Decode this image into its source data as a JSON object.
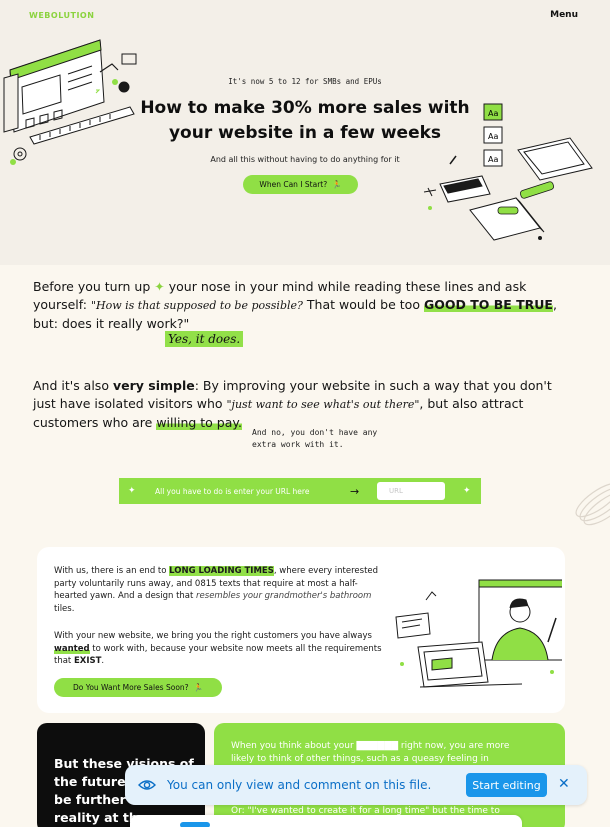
{
  "header": {
    "logo": "WEBOLUTION",
    "menu_label": "Menu"
  },
  "hero": {
    "kicker": "It's now 5 to 12 for SMBs and EPUs",
    "title_line1": "How to make 30% more sales with",
    "title_line2": "your website in a few weeks",
    "subtitle": "And all this without having to do anything for it",
    "cta_label": "When Can I Start?",
    "cta_icon": "running-person-icon",
    "art_labels": [
      "Aa",
      "Aa",
      "Aa"
    ]
  },
  "intro": {
    "p1_a": "Before you turn up",
    "p1_b": "your nose in your mind while reading these lines and ask yourself:",
    "p1_quote": "\"How is that supposed to be possible?",
    "p1_c": "That would be too",
    "p1_bold": "GOOD TO BE TRUE",
    "p1_d": ", but: does it really work?\"",
    "yes": "Yes, it does.",
    "p2_a": "And it's also",
    "p2_bold": "very simple",
    "p2_b": ": By improving your website in such a way that you don't just have isolated visitors who",
    "p2_quote": "\"just want to see what's out there\"",
    "p2_c": ", but also attract customers who are",
    "p2_hl": "willing to pay.",
    "note": "And no, you don't have any\nextra work with it."
  },
  "url_bar": {
    "text": "All you have to do is enter your URL here",
    "placeholder": "URL",
    "arrow_icon": "arrow-right-icon"
  },
  "benefits_card": {
    "t1_a": "With us, there is an end to",
    "t1_hl": "LONG LOADING TIMES",
    "t1_b": ", where every interested party voluntarily runs away, and 0815 texts that require at most a half-hearted yawn. And a design that",
    "t1_it": "resembles your grandmother's bathroom",
    "t1_c": "tiles.",
    "t2_a": "With your new website, we bring you the right customers you have always",
    "t2_hl": "wanted",
    "t2_b": "to work with, because your website now meets all the requirements that",
    "t2_bold": "EXIST",
    "t2_c": ".",
    "cta_label": "Do You Want More Sales Soon?"
  },
  "bottom": {
    "black_text": "But these visions of\nthe future c\nbe further fr\nreality at the",
    "green_text": "When you think about your ▇▇▇▇▇▇ right now, you are more likely to think of other things, such as a queasy feeling in",
    "green_text2": "Or: \"I've wanted to create it for a long time\" but the time to"
  },
  "banner": {
    "message": "You can only view and comment on this file.",
    "edit_label": "Start editing",
    "eye_icon": "eye-icon",
    "close_icon": "close-icon"
  },
  "colors": {
    "accent": "#90df45",
    "info": "#0b6fc7",
    "button": "#1a96ea"
  }
}
